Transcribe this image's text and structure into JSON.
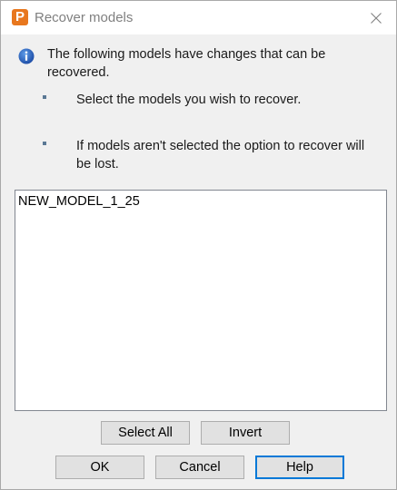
{
  "window": {
    "title": "Recover models",
    "app_icon_letter": "P",
    "app_icon_color": "#e8771e",
    "close_glyph": "close-icon"
  },
  "message": {
    "line1": "The following models have changes that can be",
    "line2": "recovered.",
    "bullet1": "Select the models you wish to recover.",
    "bullet2_line1": "If models aren't selected the option to recover will",
    "bullet2_line2": "be lost."
  },
  "model_list": {
    "items": [
      "NEW_MODEL_1_25"
    ]
  },
  "buttons": {
    "select_all": "Select All",
    "invert": "Invert",
    "ok": "OK",
    "cancel": "Cancel",
    "help": "Help"
  },
  "colors": {
    "accent": "#0078d7",
    "info_icon": "#1f5fbf"
  }
}
